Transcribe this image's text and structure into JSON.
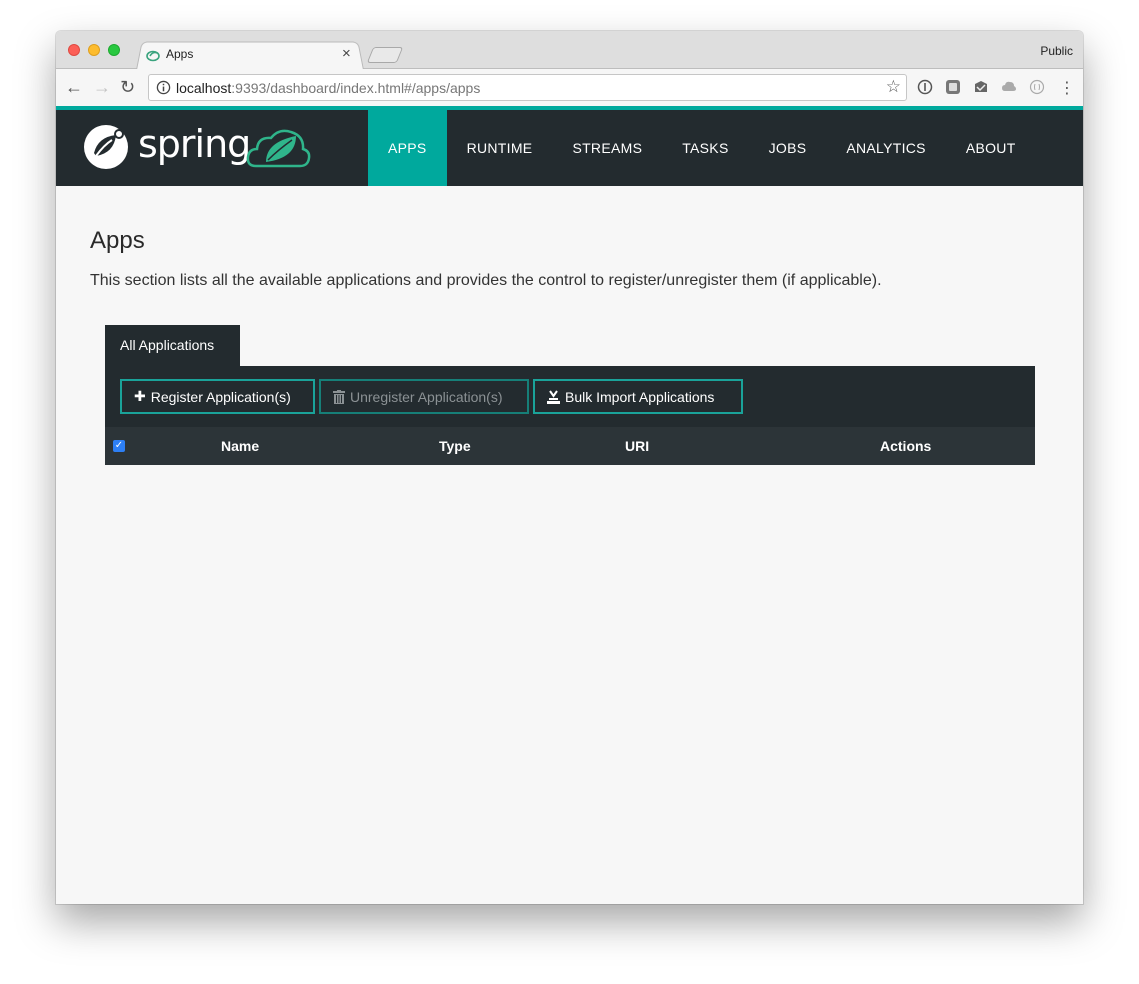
{
  "browser": {
    "tab_title": "Apps",
    "tab_close": "×",
    "profile_label": "Public",
    "url_host": "localhost",
    "url_path": ":9393/dashboard/index.html#/apps/apps",
    "icons": {
      "back": "arrow-left-icon",
      "forward": "arrow-right-icon",
      "reload": "reload-icon",
      "info": "info-icon",
      "star": "star-icon"
    }
  },
  "header": {
    "brand": "spring",
    "nav": [
      {
        "label": "APPS",
        "active": true
      },
      {
        "label": "RUNTIME",
        "active": false
      },
      {
        "label": "STREAMS",
        "active": false
      },
      {
        "label": "TASKS",
        "active": false
      },
      {
        "label": "JOBS",
        "active": false
      },
      {
        "label": "ANALYTICS",
        "active": false
      },
      {
        "label": "ABOUT",
        "active": false
      }
    ],
    "colors": {
      "accent": "#00a99d",
      "bar": "#232b2f"
    }
  },
  "main": {
    "title": "Apps",
    "description": "This section lists all the available applications and provides the control to register/unregister them (if applicable).",
    "panel_tab": "All Applications",
    "buttons": {
      "register": "Register Application(s)",
      "unregister": "Unregister Application(s)",
      "bulk_import": "Bulk Import Applications"
    },
    "table": {
      "select_all_checked": true,
      "columns": [
        "Name",
        "Type",
        "URI",
        "Actions"
      ]
    }
  }
}
